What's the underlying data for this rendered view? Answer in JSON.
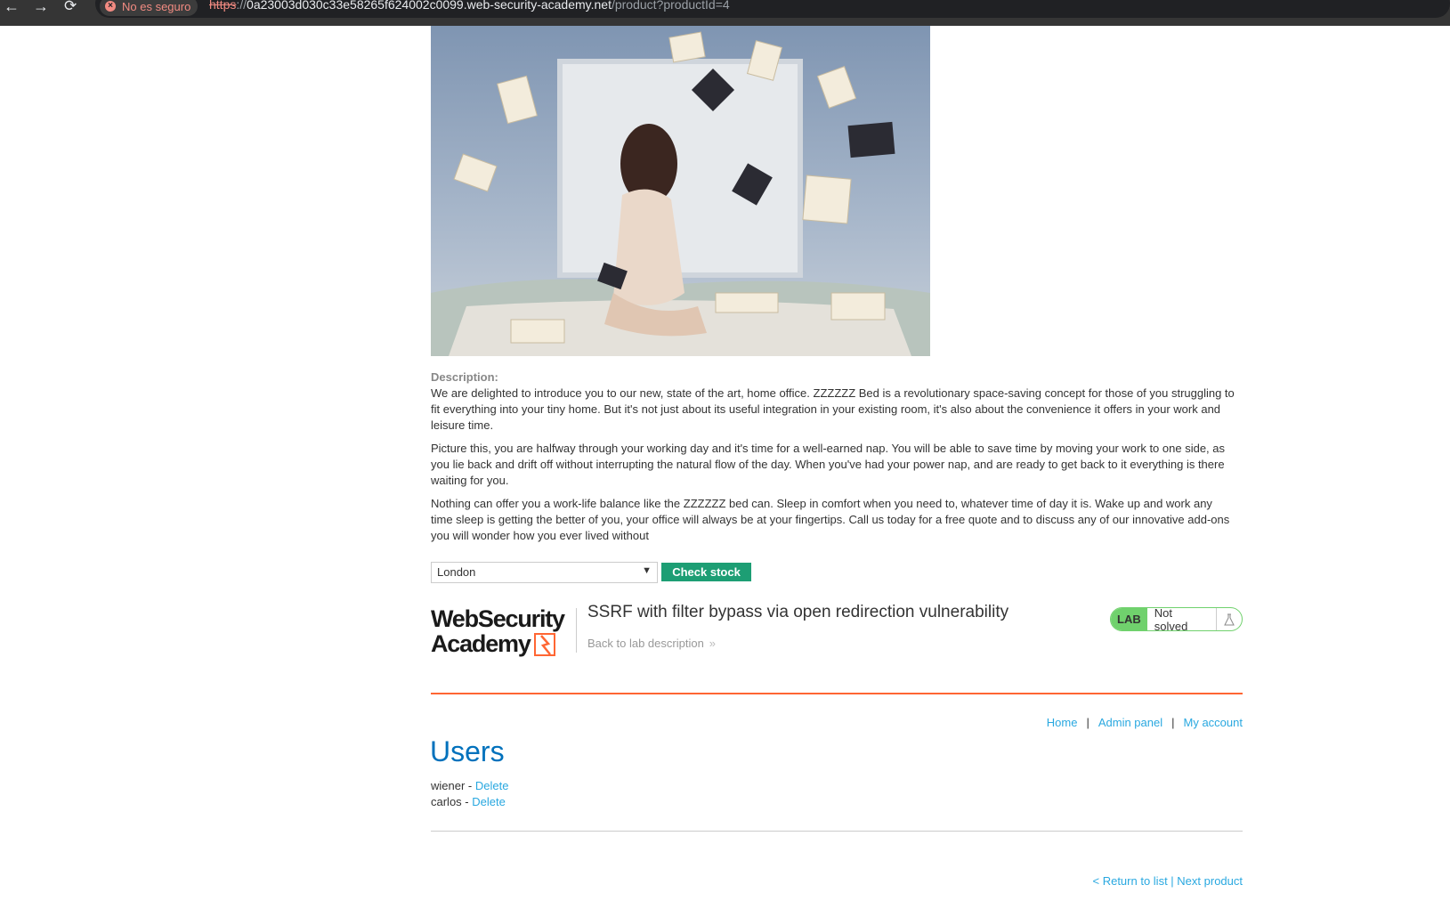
{
  "browser": {
    "back_icon": "←",
    "forward_icon": "→",
    "reload_icon": "⟳",
    "security_label": "No es seguro",
    "url_scheme": "https",
    "url_sep": "://",
    "url_host": "0a23003d030c33e58265f624002c0099.web-security-academy.net",
    "url_path": "/product?productId=4"
  },
  "product": {
    "image": "bed-room-floating-books-image",
    "description_label": "Description:",
    "description": [
      "We are delighted to introduce you to our new, state of the art, home office. ZZZZZZ Bed is a revolutionary space-saving concept for those of you struggling to fit everything into your tiny home. But it's not just about its useful integration in your existing room, it's also about the convenience it offers in your work and leisure time.",
      "Picture this, you are halfway through your working day and it's time for a well-earned nap. You will be able to save time by moving your work to one side, as you lie back and drift off without interrupting the natural flow of the day. When you've had your power nap, and are ready to get back to it everything is there waiting for you.",
      "Nothing can offer you a work-life balance like the ZZZZZZ bed can. Sleep in comfort when you need to, whatever time of day it is. Wake up and work any time sleep is getting the better of you, your office will always be at your fingertips. Call us today for a free quote and to discuss any of our innovative add-ons you will wonder how you ever lived without"
    ]
  },
  "stock": {
    "selected_store": "London",
    "check_button": "Check stock"
  },
  "lab": {
    "logo_line1": "WebSecurity",
    "logo_line2": "Academy",
    "title": "SSRF with filter bypass via open redirection vulnerability",
    "back_link": "Back to lab description",
    "badge": "LAB",
    "status": "Not solved",
    "colors": {
      "badge": "#70d16d",
      "accent_rule": "#ff6633",
      "button": "#1d9e74",
      "link": "#29a8e0",
      "heading": "#0071bc"
    }
  },
  "nav": {
    "home": "Home",
    "admin_panel": "Admin panel",
    "my_account": "My account",
    "separator": "|"
  },
  "users": {
    "heading": "Users",
    "rows": [
      {
        "name": "wiener",
        "sep": " - ",
        "action": "Delete"
      },
      {
        "name": "carlos",
        "sep": " - ",
        "action": "Delete"
      }
    ]
  },
  "footer": {
    "return_to_list": "< Return to list",
    "separator": " | ",
    "next_product": "Next product"
  }
}
